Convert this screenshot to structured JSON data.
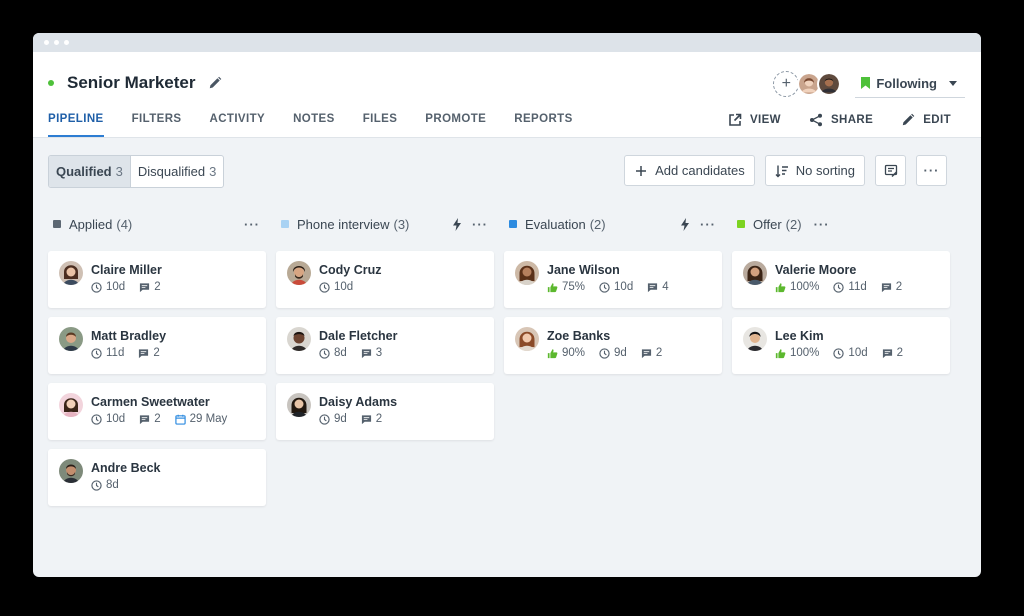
{
  "job": {
    "title": "Senior Marketer",
    "following_label": "Following"
  },
  "tabs": [
    "PIPELINE",
    "FILTERS",
    "ACTIVITY",
    "NOTES",
    "FILES",
    "PROMOTE",
    "REPORTS"
  ],
  "actions": {
    "view": "VIEW",
    "share": "SHARE",
    "edit": "EDIT"
  },
  "filter": {
    "qualified_label": "Qualified",
    "qualified_count": "3",
    "disqualified_label": "Disqualified",
    "disqualified_count": "3"
  },
  "toolbar": {
    "add_candidates": "Add candidates",
    "sorting": "No sorting"
  },
  "colors": {
    "accent": "#2d7dd2",
    "status_green": "#4ec13a",
    "score_green": "#5cb82e"
  },
  "columns": [
    {
      "name": "Applied",
      "count": "(4)",
      "color": "#5c6773",
      "cards": [
        {
          "name": "Claire Miller",
          "days": "10d",
          "comments": "2"
        },
        {
          "name": "Matt Bradley",
          "days": "11d",
          "comments": "2"
        },
        {
          "name": "Carmen Sweetwater",
          "days": "10d",
          "comments": "2",
          "date": "29 May"
        },
        {
          "name": "Andre Beck",
          "days": "8d"
        }
      ]
    },
    {
      "name": "Phone interview",
      "count": "(3)",
      "color": "#a9d2f3",
      "cards": [
        {
          "name": "Cody Cruz",
          "days": "10d"
        },
        {
          "name": "Dale Fletcher",
          "days": "8d",
          "comments": "3"
        },
        {
          "name": "Daisy Adams",
          "days": "9d",
          "comments": "2"
        }
      ]
    },
    {
      "name": "Evaluation",
      "count": "(2)",
      "color": "#2d8be0",
      "cards": [
        {
          "name": "Jane Wilson",
          "score": "75%",
          "days": "10d",
          "comments": "4"
        },
        {
          "name": "Zoe Banks",
          "score": "90%",
          "days": "9d",
          "comments": "2"
        }
      ]
    },
    {
      "name": "Offer",
      "count": "(2)",
      "color": "#7cd321",
      "cards": [
        {
          "name": "Valerie Moore",
          "score": "100%",
          "days": "11d",
          "comments": "2"
        },
        {
          "name": "Lee Kim",
          "score": "100%",
          "days": "10d",
          "comments": "2"
        }
      ]
    }
  ]
}
